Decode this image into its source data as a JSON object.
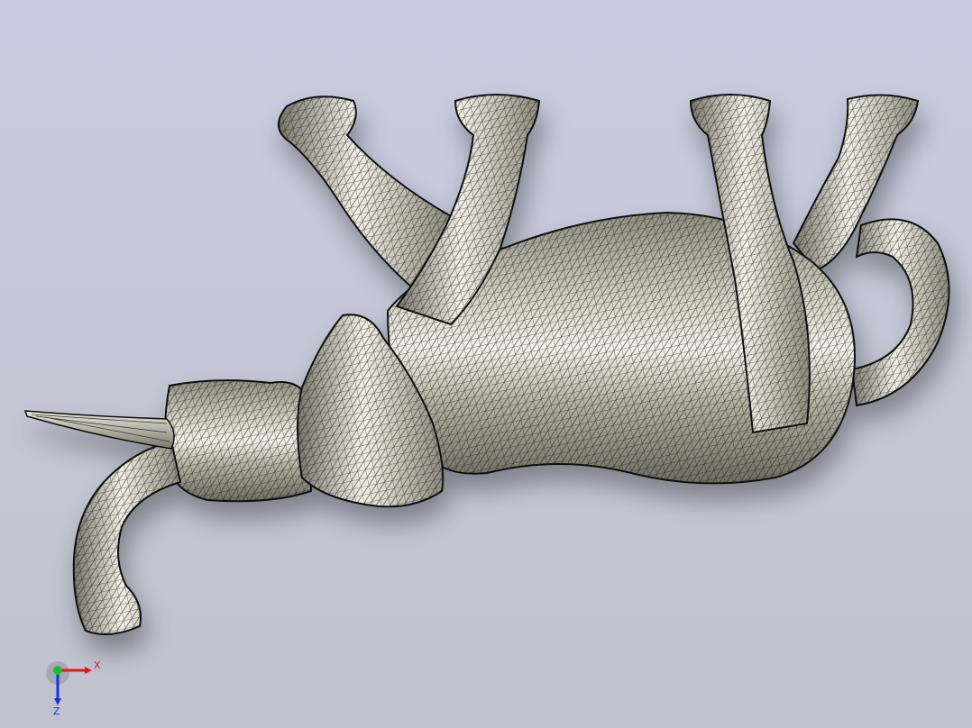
{
  "viewport": {
    "background_top": "#c9cbe0",
    "background_bottom": "#c0c2ce",
    "model_name": "",
    "model_fill": "#b9b8a6",
    "model_highlight": "#f2f1e6",
    "mesh_color": "#1a1a1a"
  },
  "triad": {
    "x_label": "X",
    "y_label": "",
    "z_label": "Z",
    "x_color": "#e01818",
    "y_color": "#18c030",
    "z_color": "#1830e0"
  }
}
